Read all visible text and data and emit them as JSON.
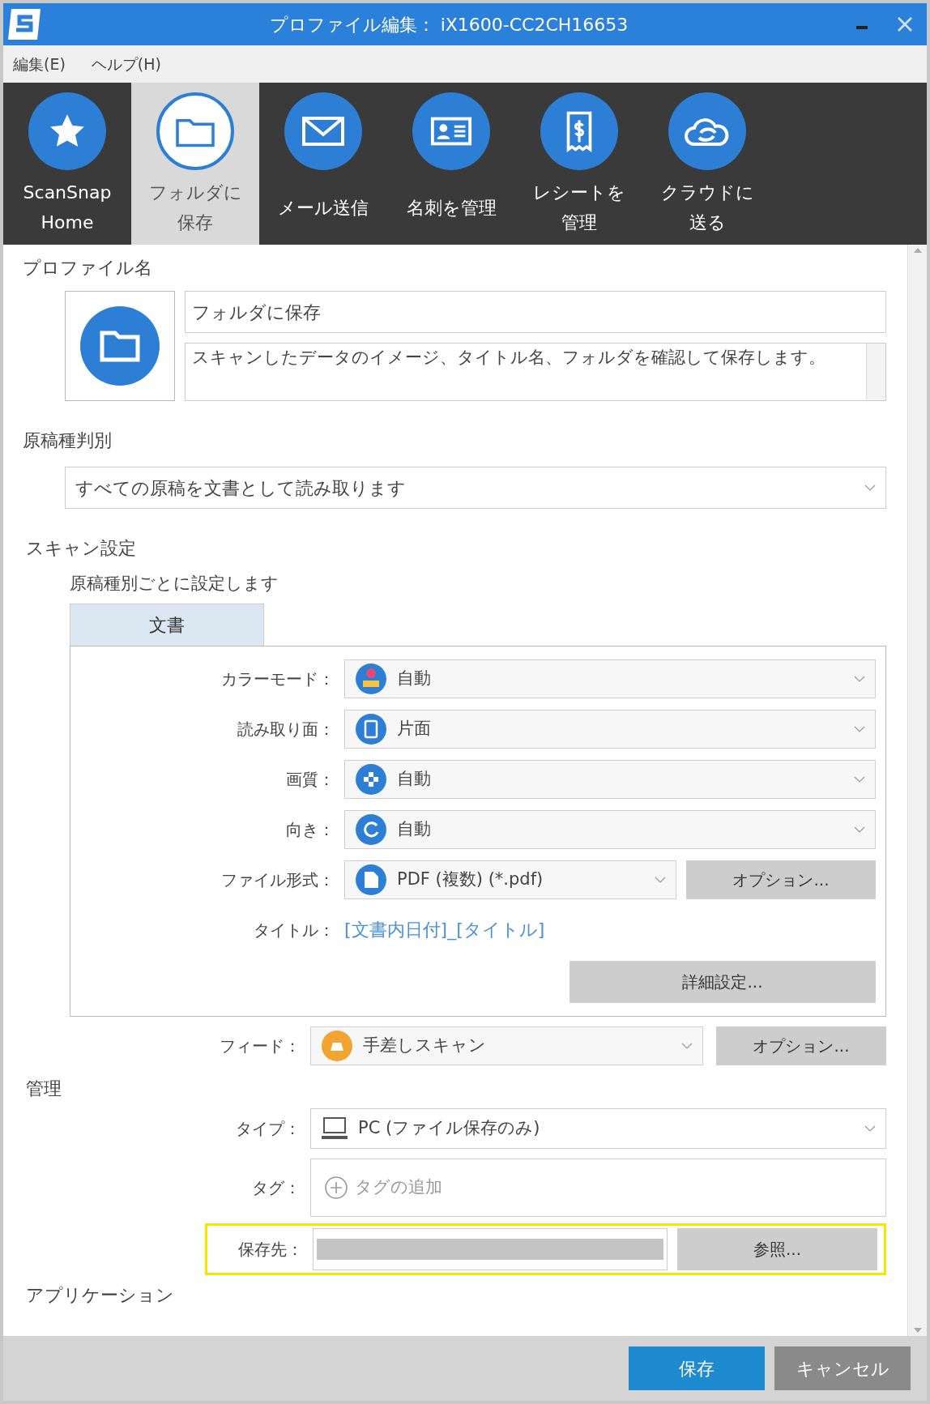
{
  "window": {
    "title": "プロファイル編集： iX1600-CC2CH16653"
  },
  "menu": [
    "編集(E)",
    "ヘルプ(H)"
  ],
  "toolbar": [
    {
      "lines": [
        "ScanSnap",
        "Home"
      ],
      "selected": false
    },
    {
      "lines": [
        "フォルダに",
        "保存"
      ],
      "selected": true
    },
    {
      "lines": [
        "メール送信"
      ],
      "selected": false
    },
    {
      "lines": [
        "名刺を管理"
      ],
      "selected": false
    },
    {
      "lines": [
        "レシートを",
        "管理"
      ],
      "selected": false
    },
    {
      "lines": [
        "クラウドに",
        "送る"
      ],
      "selected": false
    }
  ],
  "profile": {
    "heading": "プロファイル名",
    "name": "フォルダに保存",
    "description": "スキャンしたデータのイメージ、タイトル名、フォルダを確認して保存します。"
  },
  "document_type": {
    "heading": "原稿種判別",
    "value": "すべての原稿を文書として読み取ります"
  },
  "scan_settings": {
    "heading": "スキャン設定",
    "note": "原稿種別ごとに設定します",
    "tabs": [
      {
        "label": "文書",
        "selected": true
      }
    ],
    "rows": [
      {
        "kind": "select",
        "label": "カラーモード：",
        "value": "自動"
      },
      {
        "kind": "select",
        "label": "読み取り面：",
        "value": "片面"
      },
      {
        "kind": "select",
        "label": "画質：",
        "value": "自動"
      },
      {
        "kind": "select",
        "label": "向き：",
        "value": "自動"
      },
      {
        "kind": "select_button",
        "label": "ファイル形式：",
        "value": "PDF (複数) (*.pdf)",
        "button": "オプション..."
      },
      {
        "kind": "link",
        "label": "タイトル：",
        "value": "[文書内日付]_[タイトル]"
      }
    ],
    "detail_button": "詳細設定...",
    "feed": {
      "label": "フィード：",
      "value": "手差しスキャン",
      "button": "オプション..."
    }
  },
  "management": {
    "heading": "管理",
    "type": {
      "label": "タイプ：",
      "value": "PC (ファイル保存のみ)"
    },
    "tag": {
      "label": "タグ：",
      "placeholder": "タグの追加"
    },
    "destination": {
      "label": "保存先：",
      "button": "参照...",
      "highlighted": true
    }
  },
  "application": {
    "heading": "アプリケーション"
  },
  "buttons": [
    {
      "kind": "primary",
      "label": "保存"
    },
    {
      "kind": "secondary",
      "label": "キャンセル"
    }
  ]
}
